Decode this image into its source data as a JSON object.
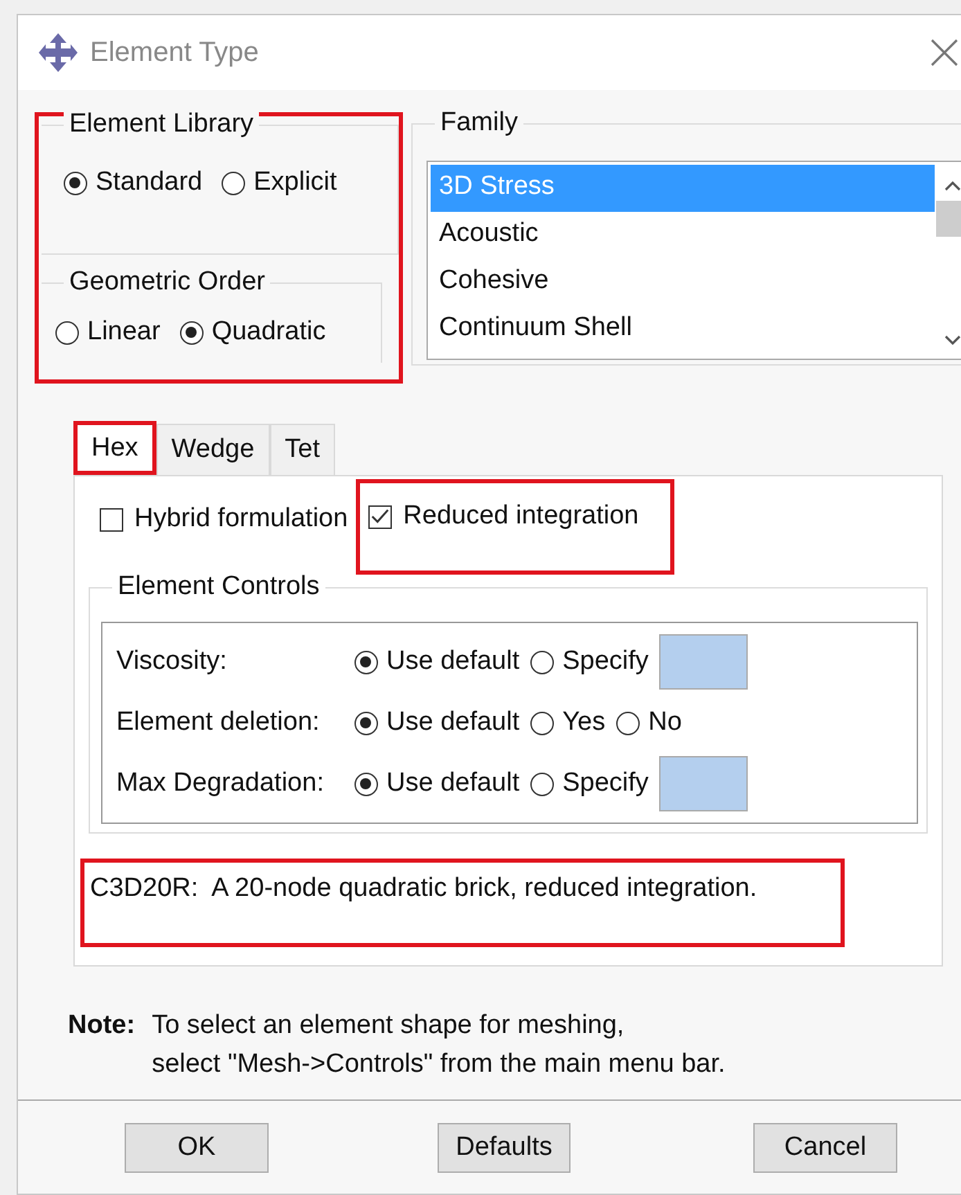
{
  "window": {
    "title": "Element Type"
  },
  "left_panel": {
    "highlighted": true,
    "groups": [
      {
        "title": "Element Library",
        "options": [
          {
            "label": "Standard",
            "selected": true
          },
          {
            "label": "Explicit",
            "selected": false
          }
        ]
      },
      {
        "title": "Geometric Order",
        "options": [
          {
            "label": "Linear",
            "selected": false
          },
          {
            "label": "Quadratic",
            "selected": true
          }
        ]
      }
    ]
  },
  "family": {
    "title": "Family",
    "items": [
      {
        "label": "3D Stress",
        "selected": true
      },
      {
        "label": "Acoustic",
        "selected": false
      },
      {
        "label": "Cohesive",
        "selected": false
      },
      {
        "label": "Continuum Shell",
        "selected": false
      }
    ]
  },
  "tabs": [
    {
      "label": "Hex",
      "selected": true,
      "highlighted": true
    },
    {
      "label": "Wedge",
      "selected": false,
      "highlighted": false
    },
    {
      "label": "Tet",
      "selected": false,
      "highlighted": false
    }
  ],
  "options": [
    {
      "label": "Hybrid formulation",
      "checked": false,
      "highlighted": false
    },
    {
      "label": "Reduced integration",
      "checked": true,
      "highlighted": true
    }
  ],
  "element_controls": {
    "title": "Element Controls",
    "rows": [
      {
        "label": "Viscosity:",
        "field": true,
        "options": [
          {
            "label": "Use default",
            "selected": true
          },
          {
            "label": "Specify",
            "selected": false
          }
        ]
      },
      {
        "label": "Element deletion:",
        "field": false,
        "options": [
          {
            "label": "Use default",
            "selected": true
          },
          {
            "label": "Yes",
            "selected": false
          },
          {
            "label": "No",
            "selected": false
          }
        ]
      },
      {
        "label": "Max Degradation:",
        "field": true,
        "options": [
          {
            "label": "Use default",
            "selected": true
          },
          {
            "label": "Specify",
            "selected": false
          }
        ]
      }
    ]
  },
  "description": {
    "text": "C3D20R:  A 20-node quadratic brick, reduced integration.",
    "highlighted": true
  },
  "note": {
    "label": "Note:",
    "lines": [
      "To select an element shape for meshing,",
      "select \"Mesh->Controls\" from the main menu bar."
    ]
  },
  "buttons": [
    "OK",
    "Defaults",
    "Cancel"
  ]
}
